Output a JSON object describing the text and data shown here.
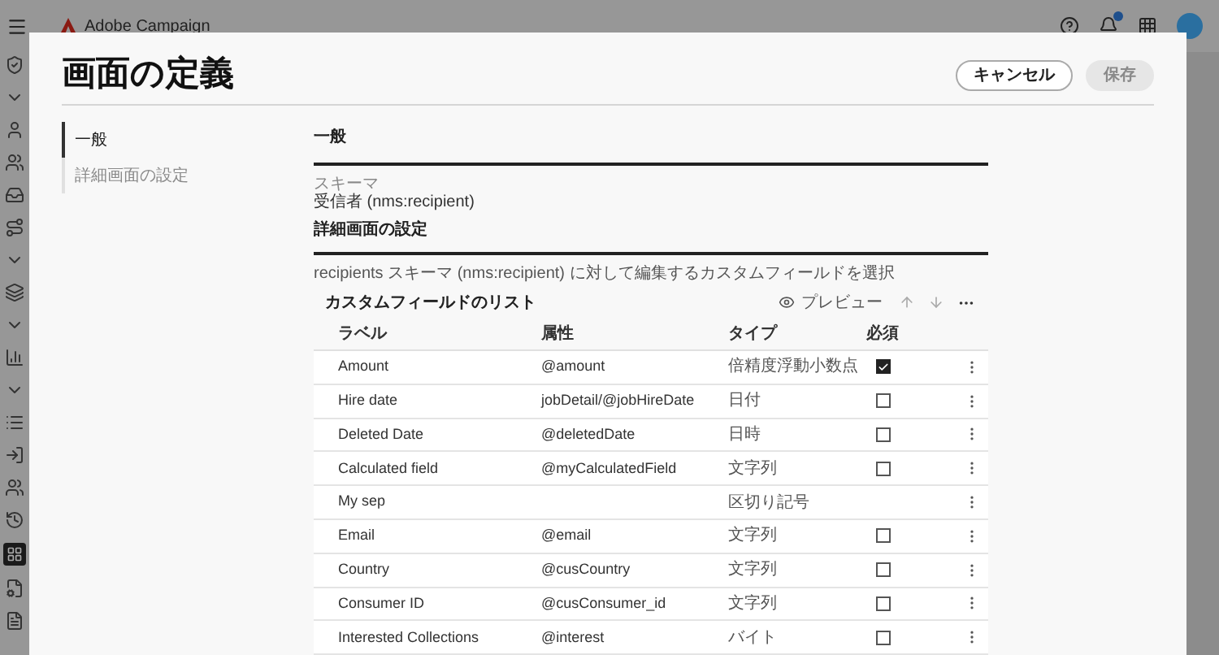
{
  "app": {
    "title": "Adobe Campaign"
  },
  "dialog": {
    "title": "画面の定義",
    "buttons": [
      {
        "label": "キャンセル",
        "kind": "secondary",
        "disabled": false
      },
      {
        "label": "保存",
        "kind": "primary",
        "disabled": true
      }
    ],
    "nav": [
      {
        "label": "一般",
        "selected": true
      },
      {
        "label": "詳細画面の設定",
        "selected": false
      }
    ],
    "general": {
      "heading": "一般",
      "schema_label": "スキーマ",
      "schema_value": "受信者 (nms:recipient)"
    },
    "detail": {
      "heading": "詳細画面の設定",
      "description": "recipients スキーマ (nms:recipient) に対して編集するカスタムフィールドを選択",
      "list_title": "カスタムフィールドのリスト",
      "preview": "プレビュー",
      "columns": [
        "ラベル",
        "属性",
        "タイプ",
        "必須"
      ],
      "rows": [
        {
          "kind": "field",
          "label": "Amount",
          "attribute": "@amount",
          "type": "倍精度浮動小数点",
          "required": true
        },
        {
          "kind": "field",
          "label": "Hire date",
          "attribute": "jobDetail/@jobHireDate",
          "type": "日付",
          "required": false
        },
        {
          "kind": "field",
          "label": "Deleted Date",
          "attribute": "@deletedDate",
          "type": "日時",
          "required": false
        },
        {
          "kind": "field",
          "label": "Calculated field",
          "attribute": "@myCalculatedField",
          "type": "文字列",
          "required": false
        },
        {
          "kind": "separator",
          "label": "My sep",
          "type": "区切り記号"
        },
        {
          "kind": "field",
          "label": "Email",
          "attribute": "@email",
          "type": "文字列",
          "required": false
        },
        {
          "kind": "field",
          "label": "Country",
          "attribute": "@cusCountry",
          "type": "文字列",
          "required": false
        },
        {
          "kind": "field",
          "label": "Consumer ID",
          "attribute": "@cusConsumer_id",
          "type": "文字列",
          "required": false
        },
        {
          "kind": "field",
          "label": "Interested Collections",
          "attribute": "@interest",
          "type": "バイト",
          "required": false
        }
      ]
    }
  }
}
